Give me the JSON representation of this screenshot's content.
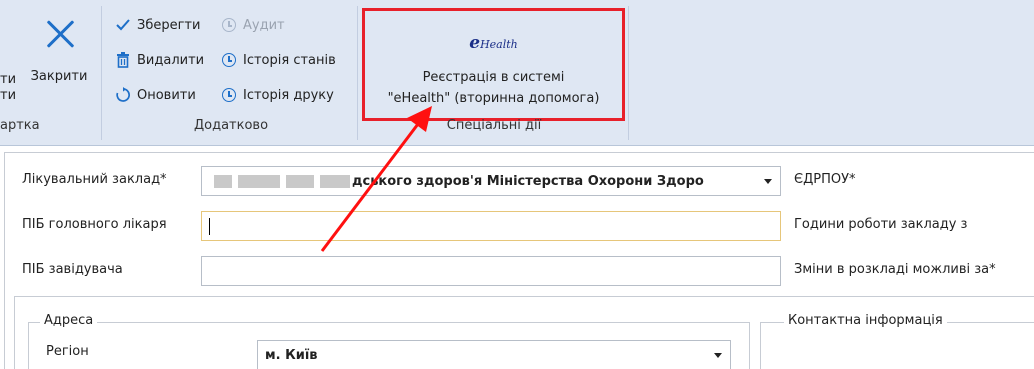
{
  "ribbon": {
    "card_group": {
      "close_label": "Закрити",
      "cut_left_label_1": "ти",
      "cut_left_label_2": "ти",
      "group_label": "артка"
    },
    "extra_group": {
      "save_label": "Зберегти",
      "audit_label": "Аудит",
      "delete_label": "Видалити",
      "state_history_label": "Історія станів",
      "refresh_label": "Оновити",
      "print_history_label": "Історія друку",
      "group_label": "Додатково"
    },
    "special_group": {
      "logo_text": "Health",
      "logo_initial": "e",
      "ehealth_line1": "Реєстрація в системі",
      "ehealth_line2": "\"eHealth\" (вторинна допомога)",
      "group_label": "Спеціальні дії"
    }
  },
  "form": {
    "facility_label": "Лікувальний заклад*",
    "facility_value": "дського здоров'я Міністерства Охорони Здоро",
    "edrpou_label": "ЄДРПОУ*",
    "chief_doctor_label": "ПІБ головного лікаря",
    "chief_doctor_value": "",
    "work_hours_label": "Години роботи закладу з",
    "head_label": "ПІБ завідувача",
    "head_value": "",
    "schedule_changes_label": "Зміни в розкладі можливі за*",
    "address_legend": "Адреса",
    "region_label": "Регіон",
    "region_value": "м. Київ",
    "contact_legend": "Контактна інформація"
  },
  "colors": {
    "ribbon_bg": "#dfe7f3",
    "highlight_red": "#e8202a",
    "accent_blue": "#1e6fc8",
    "focus_border": "#e6c67a"
  },
  "icons": {
    "close": "close-icon",
    "save": "checkmark-icon",
    "audit": "clock-icon",
    "delete": "trash-icon",
    "history": "clock-icon",
    "refresh": "refresh-icon",
    "logo": "ehealth-logo-icon",
    "dropdown": "chevron-down-icon",
    "annotation": "red-arrow-annotation"
  }
}
